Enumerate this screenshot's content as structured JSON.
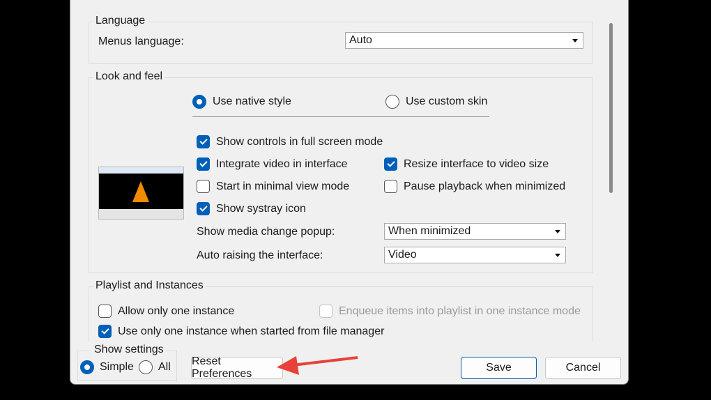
{
  "language": {
    "title": "Language",
    "menus_label": "Menus language:",
    "menus_value": "Auto"
  },
  "look": {
    "title": "Look and feel",
    "native": "Use native style",
    "custom": "Use custom skin",
    "show_controls": "Show controls in full screen mode",
    "integrate": "Integrate video in interface",
    "resize": "Resize interface to video size",
    "minimal": "Start in minimal view mode",
    "pause": "Pause playback when minimized",
    "systray": "Show systray icon",
    "popup_label": "Show media change popup:",
    "popup_value": "When minimized",
    "raise_label": "Auto raising the interface:",
    "raise_value": "Video"
  },
  "playlist": {
    "title": "Playlist and Instances",
    "one_instance": "Allow only one instance",
    "enqueue": "Enqueue items into playlist in one instance mode",
    "file_manager": "Use only one instance when started from file manager"
  },
  "footer": {
    "show_settings": "Show settings",
    "simple": "Simple",
    "all": "All",
    "reset": "Reset Preferences",
    "save": "Save",
    "cancel": "Cancel"
  },
  "colors": {
    "accent": "#005fb8",
    "annotation": "#e8413a"
  }
}
